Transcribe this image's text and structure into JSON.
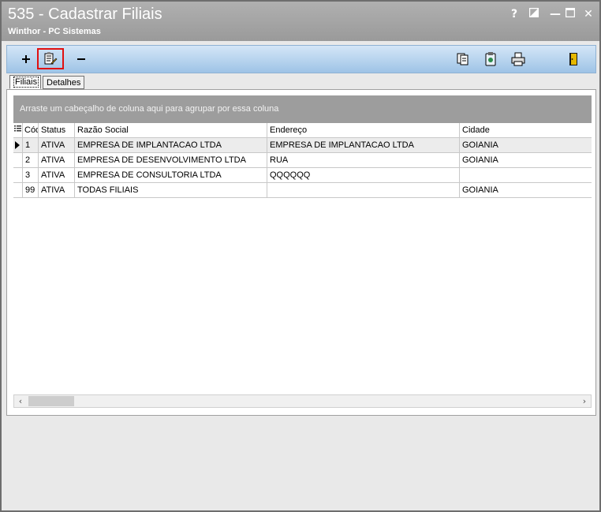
{
  "window": {
    "title": "535 - Cadastrar Filiais",
    "subtitle": "Winthor - PC Sistemas",
    "help_label": "?",
    "minimize_label": "—",
    "close_label": "✕"
  },
  "toolbar": {
    "buttons": [
      {
        "icon": "plus-icon"
      },
      {
        "icon": "edit-document-icon",
        "highlighted": true
      },
      {
        "icon": "minus-icon"
      },
      {
        "icon": "copy-pages-icon"
      },
      {
        "icon": "clipboard-icon"
      },
      {
        "icon": "printer-icon"
      },
      {
        "icon": "exit-door-icon"
      }
    ],
    "highlight_color": "#e01010"
  },
  "tabs": [
    {
      "label": "Filiais",
      "active": true
    },
    {
      "label": "Detalhes",
      "active": false
    }
  ],
  "grid": {
    "group_hint": "Arraste um cabeçalho de coluna aqui para agrupar por essa coluna",
    "columns": [
      "Código",
      "Status",
      "Razão Social",
      "Endereço",
      "Cidade"
    ],
    "rows": [
      {
        "codigo": "1",
        "status": "ATIVA",
        "razao": "EMPRESA DE IMPLANTACAO LTDA",
        "endereco": "EMPRESA DE IMPLANTACAO LTDA",
        "cidade": "GOIANIA"
      },
      {
        "codigo": "2",
        "status": "ATIVA",
        "razao": "EMPRESA DE DESENVOLVIMENTO LTDA",
        "endereco": "RUA",
        "cidade": "GOIANIA"
      },
      {
        "codigo": "3",
        "status": "ATIVA",
        "razao": "EMPRESA DE CONSULTORIA LTDA",
        "endereco": "QQQQQQ",
        "cidade": ""
      },
      {
        "codigo": "99",
        "status": "ATIVA",
        "razao": "TODAS FILIAIS",
        "endereco": "",
        "cidade": "GOIANIA"
      }
    ],
    "selected_row": 0
  }
}
